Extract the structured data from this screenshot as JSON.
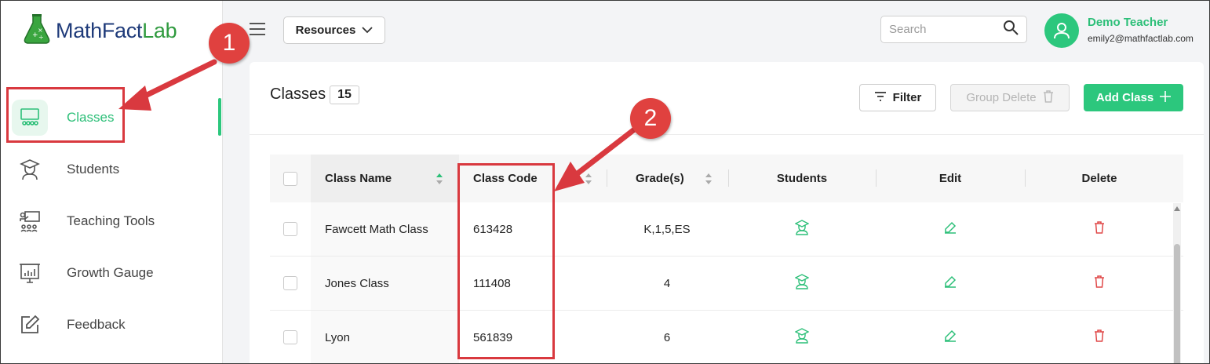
{
  "brand": {
    "name_part1": "MathFact",
    "name_part2": "Lab"
  },
  "sidebar": {
    "items": [
      {
        "label": "Classes",
        "icon": "classroom-icon",
        "active": true
      },
      {
        "label": "Students",
        "icon": "graduate-icon",
        "active": false
      },
      {
        "label": "Teaching Tools",
        "icon": "presentation-icon",
        "active": false
      },
      {
        "label": "Growth Gauge",
        "icon": "chart-board-icon",
        "active": false
      },
      {
        "label": "Feedback",
        "icon": "edit-icon",
        "active": false
      }
    ]
  },
  "topbar": {
    "resources_label": "Resources",
    "search_placeholder": "Search",
    "user_name": "Demo Teacher",
    "user_email": "emily2@mathfactlab.com"
  },
  "page": {
    "title": "Classes",
    "count": "15",
    "filter_label": "Filter",
    "group_delete_label": "Group Delete",
    "add_class_label": "Add Class"
  },
  "table": {
    "columns": [
      "Class Name",
      "Class Code",
      "Grade(s)",
      "Students",
      "Edit",
      "Delete"
    ],
    "rows": [
      {
        "name": "Fawcett Math Class",
        "code": "613428",
        "grades": "K,1,5,ES"
      },
      {
        "name": "Jones Class",
        "code": "111408",
        "grades": "4"
      },
      {
        "name": "Lyon",
        "code": "561839",
        "grades": "6"
      }
    ]
  },
  "annotations": {
    "step1": "1",
    "step2": "2"
  },
  "colors": {
    "accent": "#2cc77d",
    "brand_blue": "#1f3b7a",
    "brand_green": "#2f9a3e",
    "annotation_red": "#d9393f",
    "delete_red": "#e04848"
  }
}
